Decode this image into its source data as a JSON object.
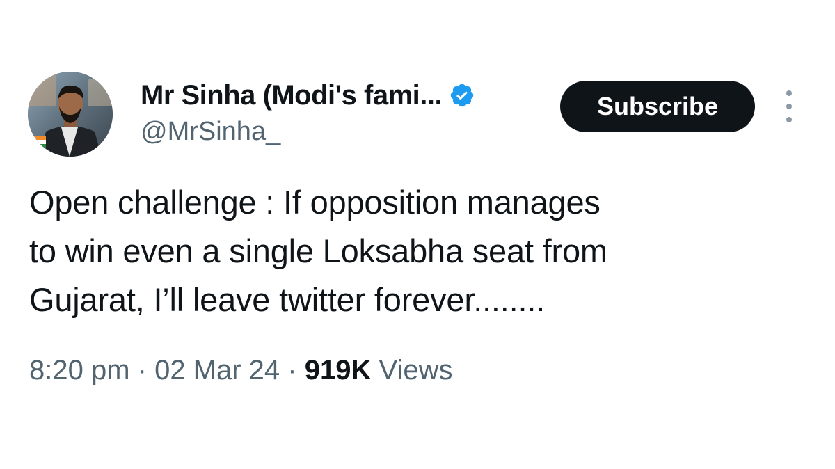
{
  "author": {
    "display_name": "Mr Sinha (Modi's fami...",
    "handle": "@MrSinha_",
    "verified": true,
    "verified_color": "#1d9bf0"
  },
  "actions": {
    "subscribe_label": "Subscribe",
    "more_icon": "more-vertical-icon"
  },
  "tweet": {
    "text": "Open challenge : If opposition manages\nto win even a single Loksabha seat from\nGujarat, I’ll leave twitter forever........"
  },
  "meta": {
    "time": "8:20 pm",
    "sep1": " · ",
    "date": "02 Mar 24",
    "sep2": " · ",
    "views_count": "919K",
    "views_label": " Views"
  },
  "colors": {
    "text_primary": "#0f1419",
    "text_secondary": "#536471",
    "button_bg": "#0f1419",
    "button_text": "#ffffff"
  }
}
